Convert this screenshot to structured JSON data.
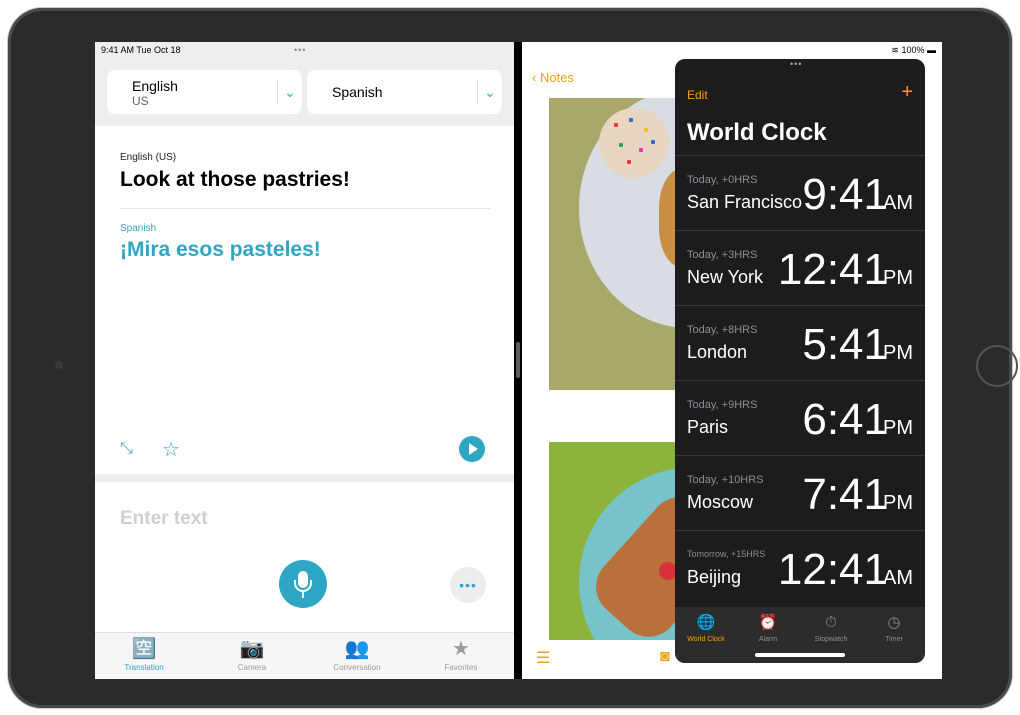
{
  "left_app": {
    "status_time": "9:41 AM  Tue Oct 18",
    "grabber": "•••",
    "source_language": {
      "name": "English",
      "region": "US"
    },
    "target_language": {
      "name": "Spanish"
    },
    "chevron": "⌄",
    "source_label": "English (US)",
    "source_text": "Look at those pastries!",
    "target_label": "Spanish",
    "target_text": "¡Mira esos pasteles!",
    "input_placeholder": "Enter text",
    "more_glyph": "•••",
    "tabs": [
      {
        "label": "Translation",
        "icon": "translate-icon",
        "glyph": "🈳",
        "active": true
      },
      {
        "label": "Camera",
        "icon": "camera-icon",
        "glyph": "📷",
        "active": false
      },
      {
        "label": "Conversation",
        "icon": "people-icon",
        "glyph": "👥",
        "active": false
      },
      {
        "label": "Favorites",
        "icon": "star-icon",
        "glyph": "★",
        "active": false
      }
    ]
  },
  "notes_app": {
    "status": "100%",
    "back_label": "Notes"
  },
  "clock_app": {
    "grabber": "•••",
    "edit_label": "Edit",
    "add_glyph": "+",
    "title": "World Clock",
    "cities": [
      {
        "sub": "Today, +0HRS",
        "city": "San Francisco",
        "time": "9:41",
        "ampm": "AM"
      },
      {
        "sub": "Today, +3HRS",
        "city": "New York",
        "time": "12:41",
        "ampm": "PM"
      },
      {
        "sub": "Today, +8HRS",
        "city": "London",
        "time": "5:41",
        "ampm": "PM"
      },
      {
        "sub": "Today, +9HRS",
        "city": "Paris",
        "time": "6:41",
        "ampm": "PM"
      },
      {
        "sub": "Today, +10HRS",
        "city": "Moscow",
        "time": "7:41",
        "ampm": "PM"
      },
      {
        "sub": "Tomorrow, +15HRS",
        "city": "Beijing",
        "time": "12:41",
        "ampm": "AM"
      }
    ],
    "tabs": [
      {
        "label": "World Clock",
        "icon": "globe-icon",
        "glyph": "🌐",
        "active": true
      },
      {
        "label": "Alarm",
        "icon": "alarm-icon",
        "glyph": "⏰",
        "active": false
      },
      {
        "label": "Stopwatch",
        "icon": "stopwatch-icon",
        "glyph": "⏱",
        "active": false
      },
      {
        "label": "Timer",
        "icon": "timer-icon",
        "glyph": "◷",
        "active": false
      }
    ]
  },
  "colors": {
    "translate_accent": "#2ea6c4",
    "notes_accent": "#e6a416",
    "clock_accent": "#ff9f0a"
  }
}
